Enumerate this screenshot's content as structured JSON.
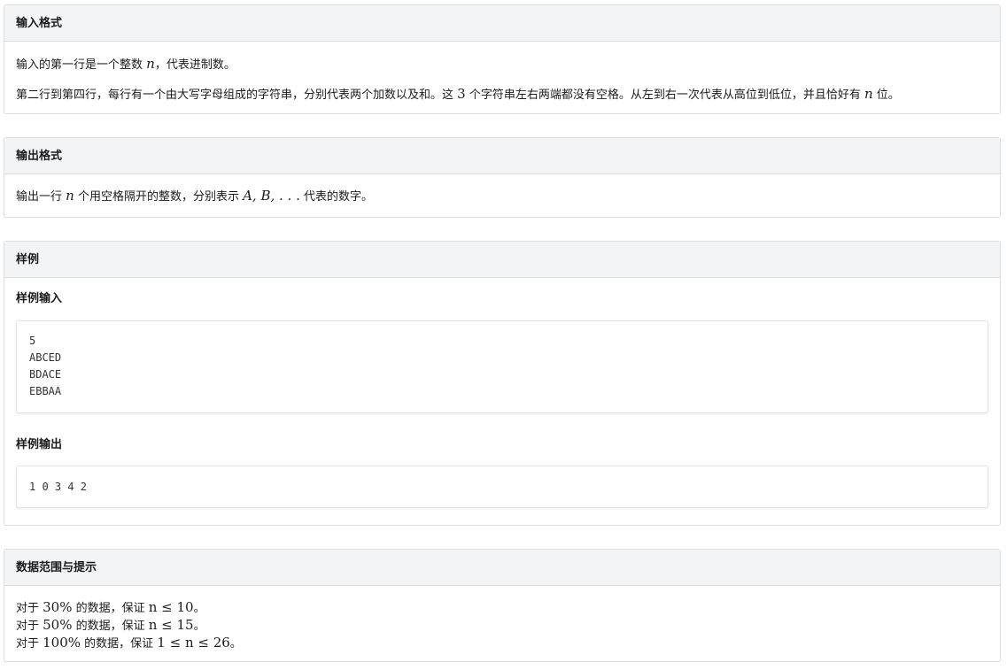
{
  "input_format": {
    "title": "输入格式",
    "line1": {
      "before": "输入的第一行是一个整数 ",
      "var": "n",
      "after": "，代表进制数。"
    },
    "line2": {
      "part1": "第二行到第四行，每行有一个由大写字母组成的字符串，分别代表两个加数以及和。这 ",
      "num": "3",
      "part2": " 个字符串左右两端都没有空格。从左到右一次代表从高位到低位，并且恰好有 ",
      "var": "n",
      "part3": " 位。"
    }
  },
  "output_format": {
    "title": "输出格式",
    "line1": {
      "before": "输出一行 ",
      "var": "n",
      "middle": " 个用空格隔开的整数，分别表示 ",
      "math": "A, B, . . .",
      "after": " 代表的数字。"
    }
  },
  "sample": {
    "title": "样例",
    "input_title": "样例输入",
    "input_lines": [
      "5",
      "ABCED",
      "BDACE",
      "EBBAA"
    ],
    "output_title": "样例输出",
    "output_lines": [
      "1 0 3 4 2"
    ]
  },
  "data_range": {
    "title": "数据范围与提示",
    "lines": [
      {
        "prefix": "对于 ",
        "percent": "30%",
        "middle": " 的数据，保证 ",
        "cond": "n ≤ 10",
        "suffix": "。"
      },
      {
        "prefix": "对于 ",
        "percent": "50%",
        "middle": " 的数据，保证 ",
        "cond": "n ≤ 15",
        "suffix": "。"
      },
      {
        "prefix": "对于 ",
        "percent": "100%",
        "middle": " 的数据，保证 ",
        "cond": "1 ≤ n ≤ 26",
        "suffix": "。"
      }
    ]
  }
}
